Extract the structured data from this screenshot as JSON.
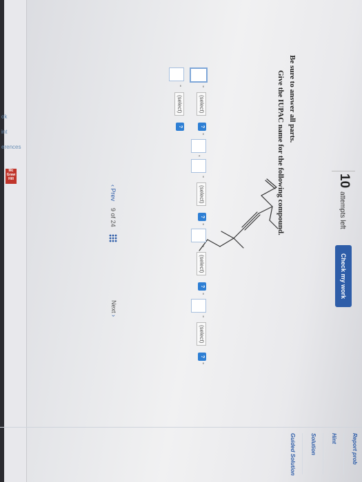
{
  "left_tabs": [
    "ok",
    "int",
    "erences"
  ],
  "logo_text": "Mc Graw Hill",
  "header": {
    "attempts_count": "10",
    "attempts_label": "attempts left",
    "check_button": "Check my work"
  },
  "question": {
    "instruction": "Be sure to answer all parts.",
    "prompt": "Give the IUPAC name for the following compound."
  },
  "answer": {
    "select_placeholder": "(select)",
    "qmark": "?",
    "dash": "-",
    "comma": ","
  },
  "navigation": {
    "prev": "Prev",
    "page_current": "9",
    "page_of": "of",
    "page_total": "24",
    "next": "Next"
  },
  "right_panel": {
    "report": "Report prob",
    "hint": "Hint",
    "solution": "Solution",
    "guided": "Guided Solution"
  },
  "colors": {
    "primary": "#2e5da8",
    "qmark_blue": "#2e7fd4"
  }
}
